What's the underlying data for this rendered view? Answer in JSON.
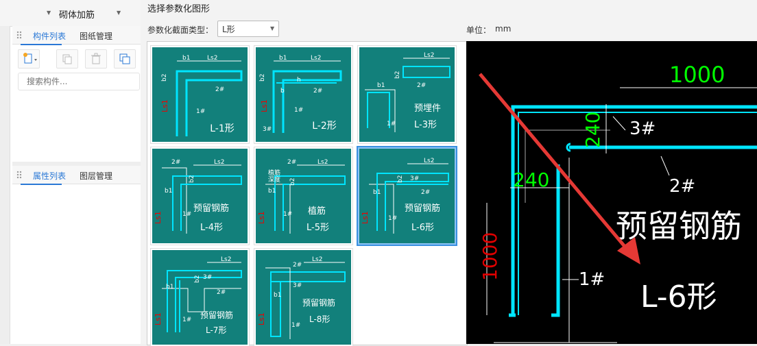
{
  "app": {
    "top_dropdown": "砌体加筋",
    "component_panel": {
      "tabs": [
        "构件列表",
        "图纸管理"
      ],
      "search_placeholder": "搜索构件..."
    },
    "property_panel": {
      "tabs": [
        "属性列表",
        "图层管理"
      ]
    }
  },
  "dialog": {
    "title": "选择参数化图形",
    "section_type_label": "参数化截面类型：",
    "section_type_value": "L形",
    "unit_label": "单位：",
    "unit_value": "mm",
    "selected_shape": "L-6形",
    "shapes": [
      {
        "label": "L-1形"
      },
      {
        "label": "L-2形"
      },
      {
        "label": "L-3形",
        "note": "预埋件"
      },
      {
        "label": "L-4形",
        "note": "预留钢筋"
      },
      {
        "label": "L-5形",
        "note": "植筋"
      },
      {
        "label": "L-6形",
        "note": "预留钢筋"
      },
      {
        "label": "L-7形",
        "note": "预留钢筋"
      },
      {
        "label": "L-8形",
        "note": "预留钢筋"
      }
    ],
    "preview": {
      "dim_top": "1000",
      "dim_v240": "240",
      "dim_h240": "240",
      "dim_left": "1000",
      "rebar_3": "3#",
      "rebar_2": "2#",
      "rebar_1": "1#",
      "note": "预留钢筋",
      "label": "L-6形"
    },
    "thumb_marks": {
      "b1": "b1",
      "b2": "b2",
      "ls2": "Ls2",
      "ls1": "Ls1",
      "r1": "1#",
      "r2": "2#",
      "r3": "3#",
      "h": "h",
      "b": "b",
      "zhijin": "植筋",
      "shendu": "深度"
    }
  },
  "colors": {
    "tile": "#12807b",
    "rebar": "#00e5ff",
    "dim_green": "#00ff00",
    "dim_red": "#e00000",
    "accent": "#2a78d6"
  }
}
